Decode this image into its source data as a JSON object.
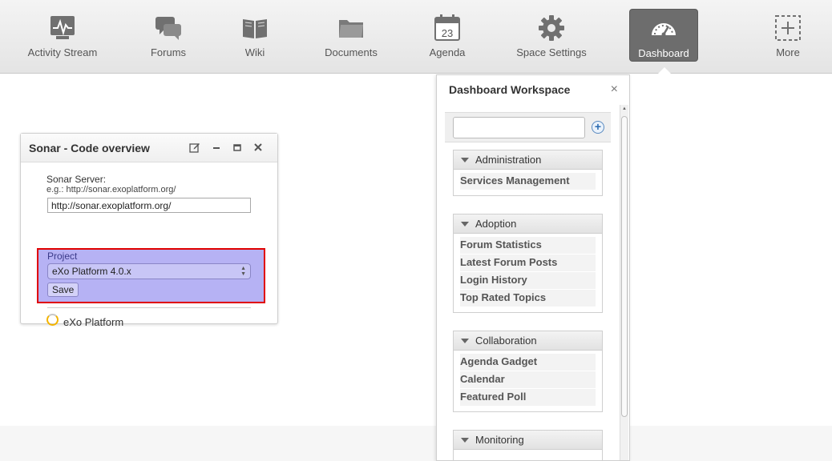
{
  "topnav": {
    "items": [
      {
        "label": "Activity Stream",
        "icon": "activity-stream-icon"
      },
      {
        "label": "Forums",
        "icon": "forums-icon"
      },
      {
        "label": "Wiki",
        "icon": "wiki-icon"
      },
      {
        "label": "Documents",
        "icon": "documents-icon"
      },
      {
        "label": "Agenda",
        "icon": "agenda-icon"
      },
      {
        "label": "Space Settings",
        "icon": "gear-icon"
      },
      {
        "label": "Dashboard",
        "icon": "dashboard-icon",
        "active": true
      },
      {
        "label": "More",
        "icon": "more-icon"
      }
    ],
    "agenda_day": "23"
  },
  "gadget": {
    "title": "Sonar - Code overview",
    "server_label": "Sonar Server:",
    "server_hint": "e.g.: http://sonar.exoplatform.org/",
    "server_value": "http://sonar.exoplatform.org/",
    "project_label": "Project",
    "project_selected": "eXo Platform 4.0.x",
    "save_label": "Save",
    "project_name": "eXo Platform"
  },
  "workspace": {
    "title": "Dashboard Workspace",
    "close": "×",
    "add": "+",
    "categories": [
      {
        "label": "Administration",
        "items": [
          "Services Management"
        ]
      },
      {
        "label": "Adoption",
        "items": [
          "Forum Statistics",
          "Latest Forum Posts",
          "Login History",
          "Top Rated Topics"
        ]
      },
      {
        "label": "Collaboration",
        "items": [
          "Agenda Gadget",
          "Calendar",
          "Featured Poll"
        ]
      },
      {
        "label": "Monitoring",
        "items": []
      }
    ]
  },
  "colors": {
    "highlight_fill": "#b6b2f4",
    "highlight_border": "#e00000",
    "active_tab": "#6d6d6d"
  }
}
